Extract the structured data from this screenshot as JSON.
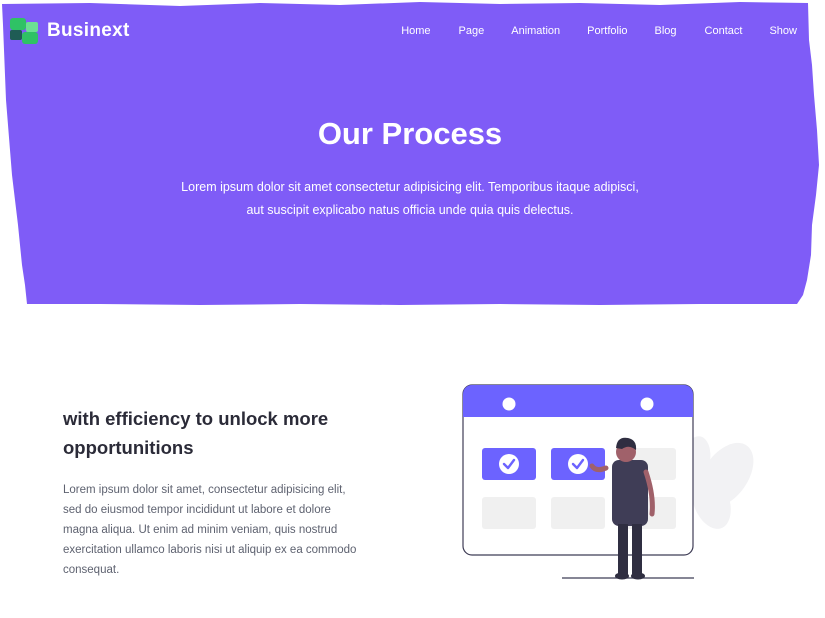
{
  "brand": {
    "name": "Businext",
    "primary_color": "#7f5cf7",
    "icon_colors": [
      "#2fc265",
      "#6ce093",
      "#1f5c55"
    ]
  },
  "nav": {
    "items": [
      "Home",
      "Page",
      "Animation",
      "Portfolio",
      "Blog",
      "Contact",
      "Show"
    ]
  },
  "hero": {
    "title": "Our Process",
    "description": "Lorem ipsum dolor sit amet consectetur adipisicing elit. Temporibus itaque adipisci, aut suscipit explicabo natus officia unde quia quis delectus."
  },
  "content": {
    "heading": "with efficiency to unlock more opportunitions",
    "description": "Lorem ipsum dolor sit amet, consectetur adipisicing elit, sed do eiusmod tempor incididunt ut labore et dolore magna aliqua. Ut enim ad minim veniam, quis nostrud exercitation ullamco laboris nisi ut aliquip ex ea commodo consequat."
  },
  "illustration": {
    "name": "calendar-checklist-illustration",
    "accent_color": "#6c63ff"
  }
}
